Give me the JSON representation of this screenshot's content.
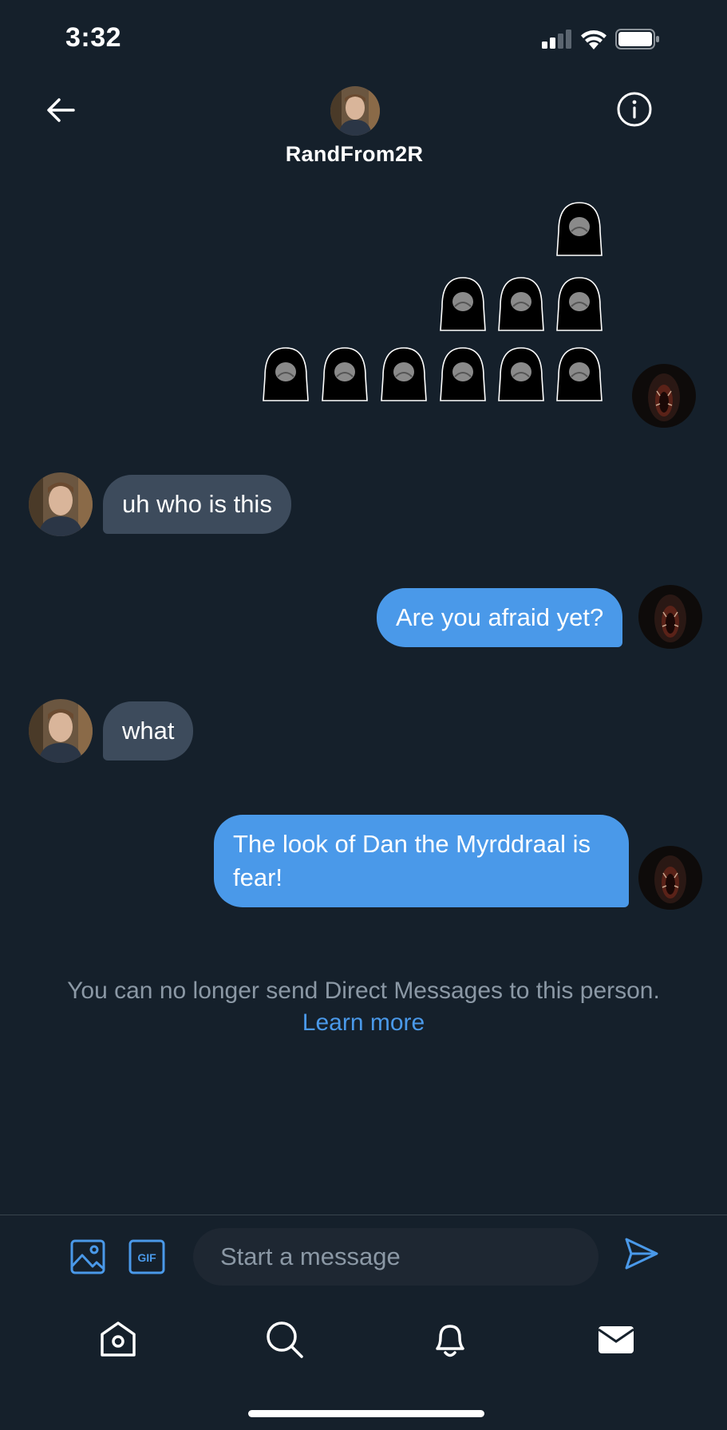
{
  "status_bar": {
    "time": "3:32",
    "battery_level": 1.0
  },
  "header": {
    "title": "RandFrom2R"
  },
  "messages": [
    {
      "direction": "out",
      "type": "emoji",
      "emoji_rows": [
        1,
        3,
        6
      ]
    },
    {
      "direction": "in",
      "text": "uh who is this"
    },
    {
      "direction": "out",
      "text": "Are you afraid yet?"
    },
    {
      "direction": "in",
      "text": "what"
    },
    {
      "direction": "out",
      "text": "The look of Dan the Myrddraal is fear!"
    }
  ],
  "notice": {
    "text": "You can no longer send Direct Messages to this person.",
    "link": "Learn more"
  },
  "composer": {
    "placeholder": "Start a message",
    "gif_label": "GIF"
  },
  "colors": {
    "background": "#15202b",
    "accent": "#4a99e9",
    "incoming_bubble": "#3d4b5c",
    "muted_text": "#8b98a5"
  },
  "icons": [
    "back-arrow-icon",
    "info-icon",
    "image-icon",
    "gif-icon",
    "send-icon",
    "home-icon",
    "search-icon",
    "bell-icon",
    "mail-icon"
  ]
}
